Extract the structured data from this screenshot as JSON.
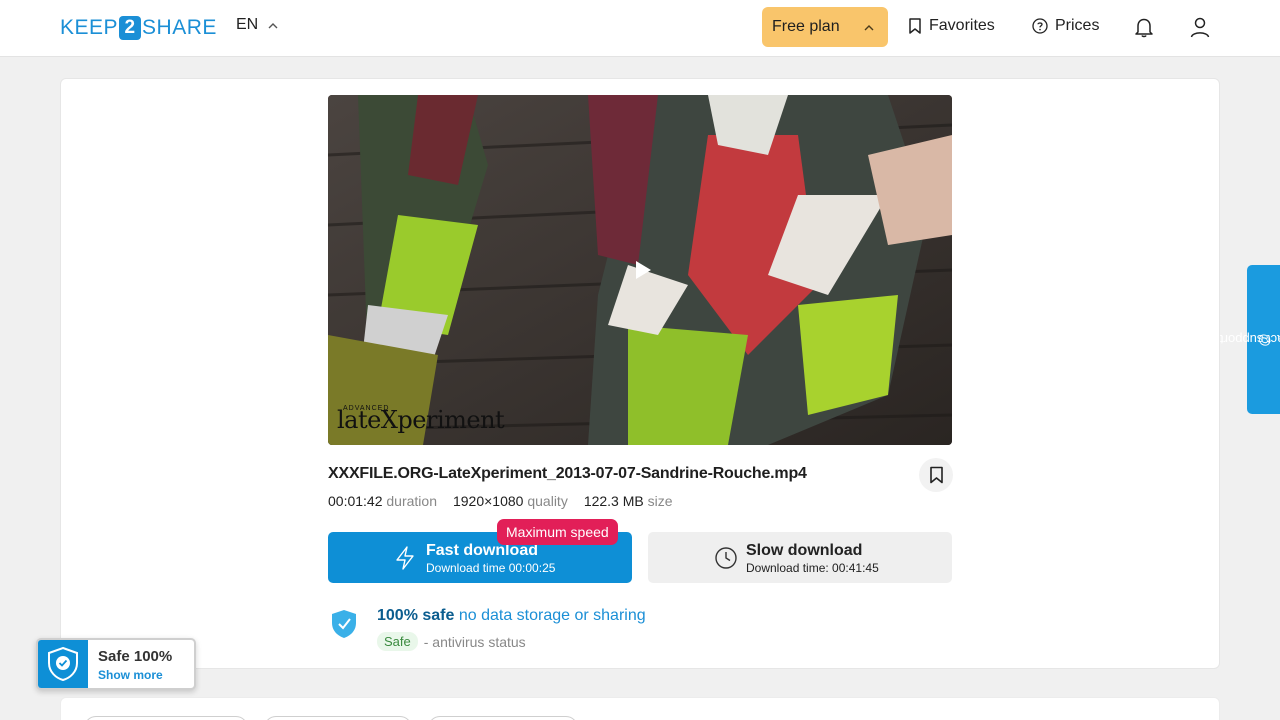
{
  "header": {
    "logo_left": "KEEP",
    "logo_mid": "2",
    "logo_right": "SHARE",
    "language": "EN",
    "plan_label": "Free plan",
    "favorites_label": "Favorites",
    "prices_label": "Prices"
  },
  "file": {
    "name": "XXXFILE.ORG-LateXperiment_2013-07-07-Sandrine-Rouche.mp4",
    "duration_value": "00:01:42",
    "duration_label": "duration",
    "quality_value": "1920×1080",
    "quality_label": "quality",
    "size_value": "122.3 MB",
    "size_label": "size",
    "watermark_small": "ADVANCED",
    "watermark": "lateXperiment"
  },
  "download": {
    "badge": "Maximum speed",
    "fast_title": "Fast download",
    "fast_time": "Download time 00:00:25",
    "slow_title": "Slow download",
    "slow_time": "Download time: 00:41:45"
  },
  "safety": {
    "bold": "100% safe",
    "rest": "no data storage or sharing",
    "badge": "Safe",
    "status": "- antivirus status"
  },
  "contact_label": "contact support",
  "widget": {
    "title": "Safe 100%",
    "link": "Show more"
  },
  "colors": {
    "brand": "#1b8fd6",
    "plan_bg": "#f9c56b",
    "max_speed": "#e21f58",
    "contact": "#1b9bdf"
  }
}
